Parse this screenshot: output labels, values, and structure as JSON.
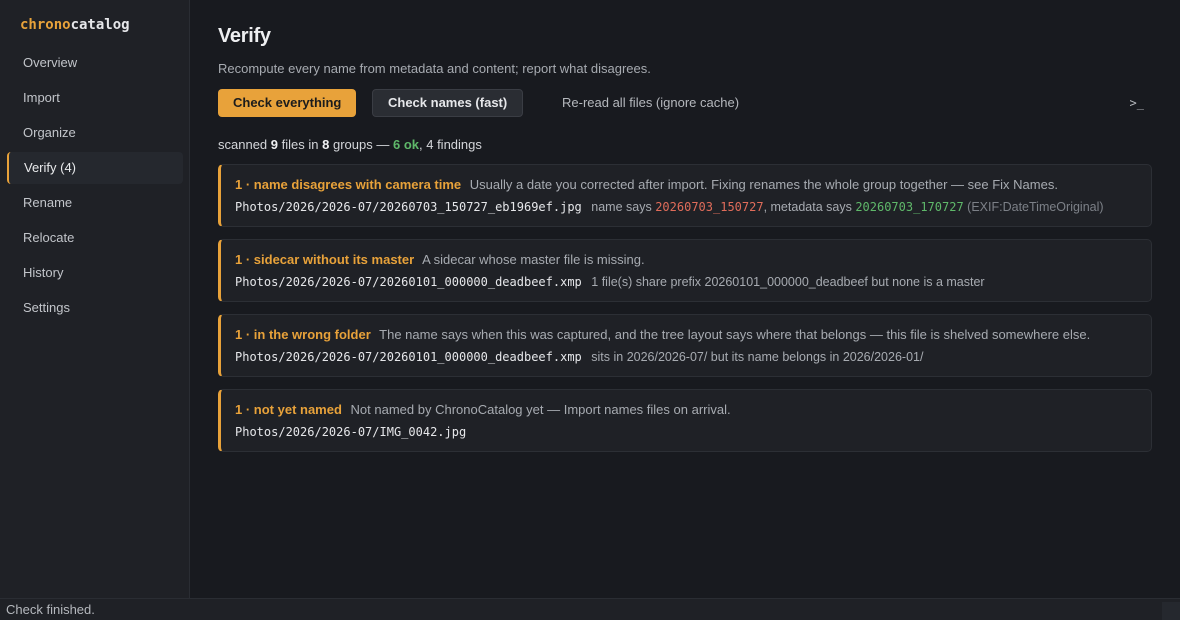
{
  "brand": {
    "part1": "chrono",
    "part2": "catalog"
  },
  "sidebar": {
    "items": [
      {
        "label": "Overview"
      },
      {
        "label": "Import"
      },
      {
        "label": "Organize"
      },
      {
        "label": "Verify (4)"
      },
      {
        "label": "Rename"
      },
      {
        "label": "Relocate"
      },
      {
        "label": "History"
      },
      {
        "label": "Settings"
      }
    ]
  },
  "main": {
    "title": "Verify",
    "subtitle": "Recompute every name from metadata and content; report what disagrees.",
    "buttons": {
      "check_everything": "Check everything",
      "check_names": "Check names (fast)",
      "reread": "Re-read all files (ignore cache)"
    },
    "console_icon": ">_",
    "summary": {
      "scanned_label": "scanned",
      "files_count": "9",
      "files_label": "files in",
      "groups_count": "8",
      "groups_label": "groups —",
      "ok": "6 ok",
      "findings": ", 4 findings"
    },
    "findings": [
      {
        "label": "1 · name disagrees with camera time",
        "desc": "Usually a date you corrected after import. Fixing renames the whole group together — see Fix Names.",
        "path": "Photos/2026/2026-07/20260703_150727_eb1969ef.jpg",
        "detail_prefix": "name says",
        "name_value": "20260703_150727",
        "detail_mid": ", metadata says",
        "meta_value": "20260703_170727",
        "detail_suffix": "(EXIF:DateTimeOriginal)"
      },
      {
        "label": "1 · sidecar without its master",
        "desc": "A sidecar whose master file is missing.",
        "path": "Photos/2026/2026-07/20260101_000000_deadbeef.xmp",
        "detail": "1 file(s) share prefix 20260101_000000_deadbeef but none is a master"
      },
      {
        "label": "1 · in the wrong folder",
        "desc": "The name says when this was captured, and the tree layout says where that belongs — this file is shelved somewhere else.",
        "path": "Photos/2026/2026-07/20260101_000000_deadbeef.xmp",
        "detail": "sits in 2026/2026-07/ but its name belongs in 2026/2026-01/"
      },
      {
        "label": "1 · not yet named",
        "desc": "Not named by ChronoCatalog yet — Import names files on arrival.",
        "path": "Photos/2026/2026-07/IMG_0042.jpg"
      }
    ]
  },
  "status": {
    "text": "Check finished."
  },
  "colors": {
    "accent": "#e8a23a",
    "ok": "#5fb86a",
    "error": "#e06c5a",
    "background": "#181a1f",
    "panel": "#1f2126"
  }
}
